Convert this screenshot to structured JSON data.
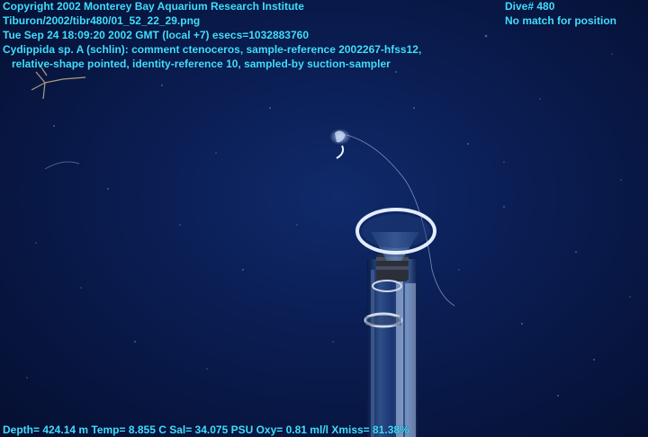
{
  "overlay": {
    "copyright": "Copyright 2002 Monterey Bay Aquarium Research Institute",
    "file_path": "Tiburon/2002/tibr480/01_52_22_29.png",
    "timestamp": "Tue Sep 24 18:09:20 2002 GMT (local +7)  esecs=1032883760",
    "annotation_line1": "Cydippida sp. A (schlin): comment ctenoceros, sample-reference 2002267-hfss12,",
    "annotation_line2": "relative-shape pointed, identity-reference 10, sampled-by suction-sampler",
    "dive_number": "Dive# 480",
    "position_status": "No match for position",
    "sensor_readout": "Depth= 424.14 m  Temp= 8.855 C  Sal= 34.075 PSU  Oxy= 0.81 ml/l  Xmiss= 81.38%"
  },
  "colors": {
    "overlay_text": "#42dcff",
    "water_center": "#102a6a",
    "water_edge": "#050f30"
  }
}
